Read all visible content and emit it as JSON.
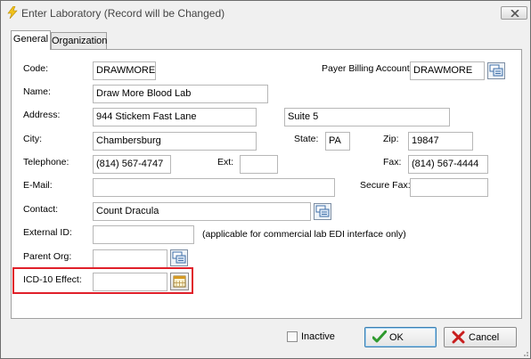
{
  "window": {
    "title": "Enter Laboratory  (Record will be Changed)"
  },
  "tabs": [
    {
      "label": "General",
      "active": true
    },
    {
      "label": "Organization",
      "active": false
    }
  ],
  "form": {
    "code": {
      "label": "Code:",
      "value": "DRAWMORE"
    },
    "payer_billing_account": {
      "label": "Payer Billing Account:",
      "value": "DRAWMORE"
    },
    "name": {
      "label": "Name:",
      "value": "Draw More Blood Lab"
    },
    "address": {
      "label": "Address:",
      "line1": "944 Stickem Fast Lane",
      "line2": "Suite 5"
    },
    "city": {
      "label": "City:",
      "value": "Chambersburg"
    },
    "state": {
      "label": "State:",
      "value": "PA"
    },
    "zip": {
      "label": "Zip:",
      "value": "19847"
    },
    "telephone": {
      "label": "Telephone:",
      "value": "(814) 567-4747"
    },
    "ext": {
      "label": "Ext:",
      "value": ""
    },
    "fax": {
      "label": "Fax:",
      "value": "(814) 567-4444"
    },
    "email": {
      "label": "E-Mail:",
      "value": ""
    },
    "secure_fax": {
      "label": "Secure Fax:",
      "value": ""
    },
    "contact": {
      "label": "Contact:",
      "value": "Count Dracula"
    },
    "external_id": {
      "label": "External ID:",
      "value": "",
      "note": "(applicable for commercial lab EDI interface only)"
    },
    "parent_org": {
      "label": "Parent Org:",
      "value": ""
    },
    "icd10_effect": {
      "label": "ICD-10 Effect:",
      "value": ""
    }
  },
  "footer": {
    "inactive_label": "Inactive",
    "inactive_checked": false,
    "ok_label": "OK",
    "cancel_label": "Cancel"
  },
  "icons": {
    "title": "lightning-bolt-icon",
    "close": "close-icon",
    "lookup": "lookup-cards-icon",
    "calendar": "calendar-icon",
    "ok": "checkmark-icon",
    "cancel": "red-x-icon"
  },
  "colors": {
    "highlight": "#e0202a",
    "ok_check": "#2f9a2f",
    "cancel_x": "#c81e1e"
  }
}
